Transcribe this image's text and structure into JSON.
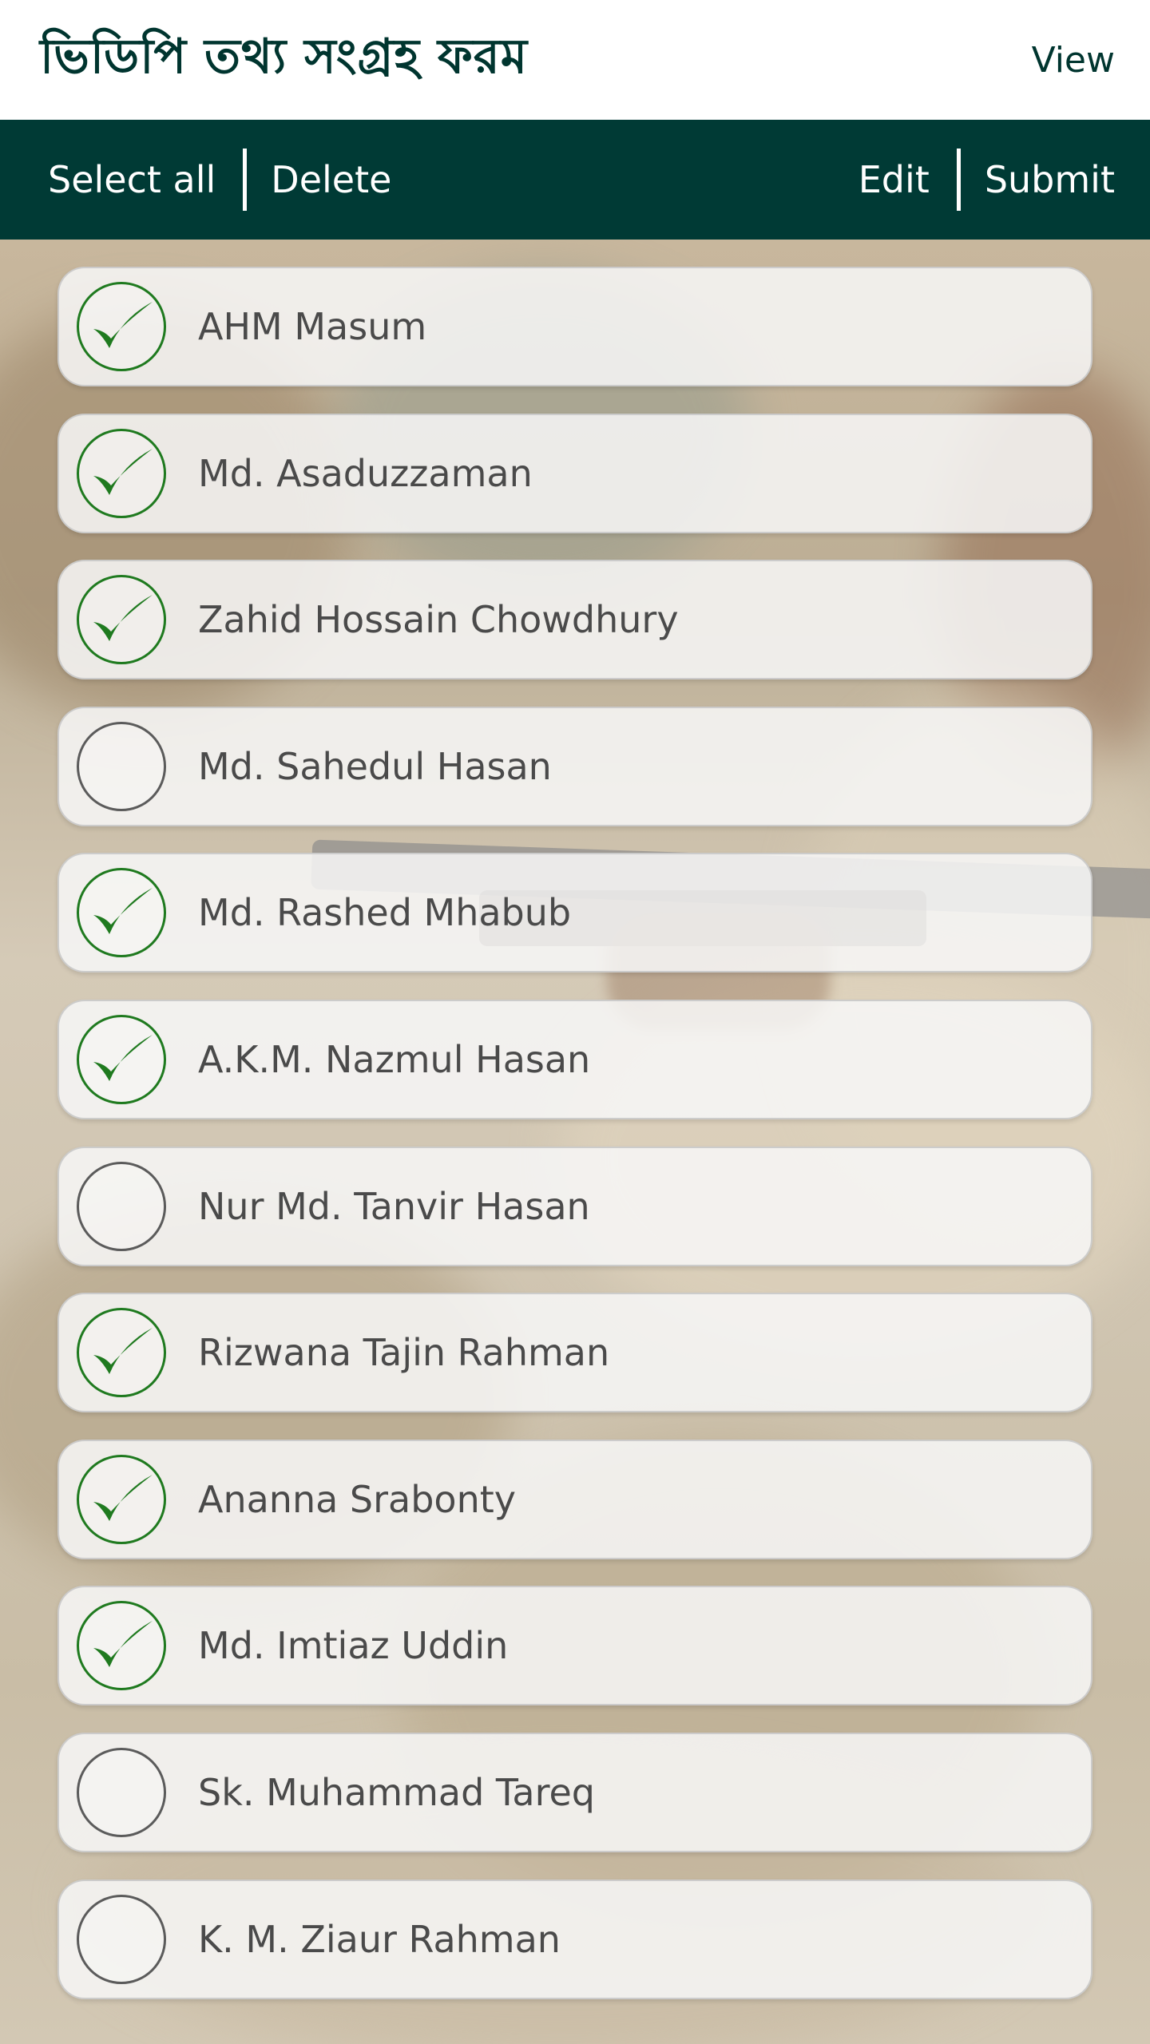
{
  "header": {
    "title": "ভিডিপি তথ্য সংগ্রহ ফরম",
    "view_label": "View"
  },
  "toolbar": {
    "select_all_label": "Select all",
    "delete_label": "Delete",
    "edit_label": "Edit",
    "submit_label": "Submit"
  },
  "colors": {
    "header_bg": "#ffffff",
    "toolbar_bg": "#003a35",
    "title_color": "#00352f",
    "check_color": "#1f7a1f"
  },
  "list": {
    "items": [
      {
        "name": "AHM Masum",
        "checked": true
      },
      {
        "name": "Md. Asaduzzaman",
        "checked": true
      },
      {
        "name": "Zahid Hossain Chowdhury",
        "checked": true
      },
      {
        "name": "Md. Sahedul Hasan",
        "checked": false
      },
      {
        "name": "Md. Rashed Mhabub",
        "checked": true
      },
      {
        "name": "A.K.M. Nazmul Hasan",
        "checked": true
      },
      {
        "name": "Nur Md. Tanvir Hasan",
        "checked": false
      },
      {
        "name": "Rizwana Tajin Rahman",
        "checked": true
      },
      {
        "name": "Ananna Srabonty",
        "checked": true
      },
      {
        "name": "Md. Imtiaz Uddin",
        "checked": true
      },
      {
        "name": "Sk. Muhammad Tareq",
        "checked": false
      },
      {
        "name": "K. M. Ziaur Rahman",
        "checked": false
      }
    ]
  }
}
